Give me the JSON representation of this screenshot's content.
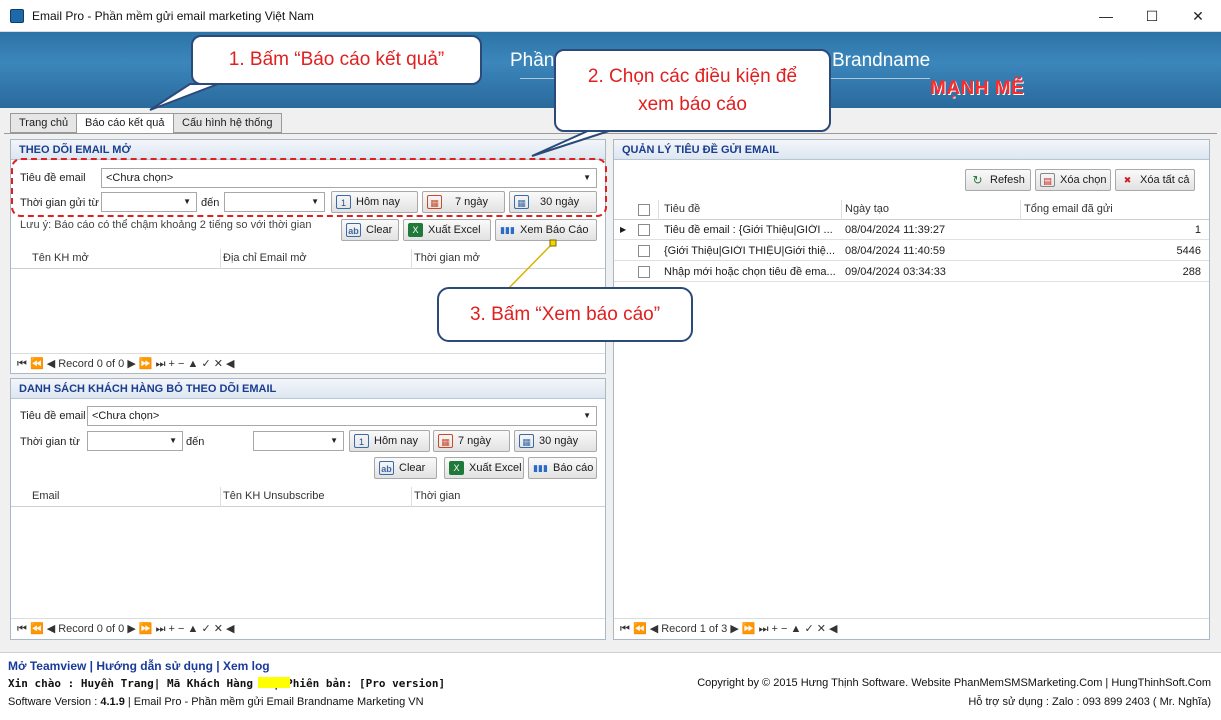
{
  "window": {
    "title": "Email Pro - Phần mềm gửi email marketing Việt Nam",
    "minimize": "—",
    "maximize": "☐",
    "close": "✕"
  },
  "banner": {
    "text1": "Phần",
    "text2": "Brandname",
    "text3": "MẠNH MẼ"
  },
  "tabs": [
    "Trang chủ",
    "Báo cáo kết quả",
    "Cấu hình hệ thống"
  ],
  "callouts": {
    "c1": "1. Bấm “Báo cáo kết quả”",
    "c2": "2. Chọn các điều kiện để xem báo cáo",
    "c3": "3. Bấm “Xem báo cáo”"
  },
  "open_panel": {
    "header": "THEO DÕI EMAIL MỞ",
    "subject_label": "Tiêu đề email",
    "subject_value": "<Chưa chọn>",
    "from_label": "Thời gian gửi từ",
    "to_label": "đến",
    "today": "Hôm nay",
    "d7": "7 ngày",
    "d30": "30 ngày",
    "note": "Lưu ý: Báo cáo có thể chậm khoảng 2 tiếng so với thời gian",
    "clear": "Clear",
    "excel": "Xuất Excel",
    "report": "Xem Báo Cáo",
    "columns": [
      "Tên KH mở",
      "Địa chỉ Email mở",
      "Thời gian mở"
    ],
    "nav": "⏮ ⏪ ◀ Record 0 of 0 ▶ ⏩ ⏭ + − ▲ ✓ ✕ ◀"
  },
  "unsub_panel": {
    "header": "DANH SÁCH KHÁCH HÀNG BỎ THEO DÕI EMAIL",
    "subject_label": "Tiêu đề email",
    "subject_value": "<Chưa chọn>",
    "from_label": "Thời gian từ",
    "to_label": "đến",
    "today": "Hôm nay",
    "d7": "7 ngày",
    "d30": "30 ngày",
    "clear": "Clear",
    "excel": "Xuất Excel",
    "report": "Báo cáo",
    "columns": [
      "Email",
      "Tên KH Unsubscribe",
      "Thời gian"
    ],
    "nav": "⏮ ⏪ ◀ Record 0 of 0 ▶ ⏩ ⏭ + − ▲ ✓ ✕ ◀"
  },
  "subject_panel": {
    "header": "QUẢN LÝ TIÊU ĐỀ GỬI EMAIL",
    "refresh": "Refesh",
    "del_sel": "Xóa chọn",
    "del_all": "Xóa tất cả",
    "columns": [
      "Tiêu đề",
      "Ngày tạo",
      "Tổng email đã gửi"
    ],
    "rows": [
      {
        "title": "Tiêu đề email : {Giới Thiệu|GIỚI ...",
        "date": "08/04/2024 11:39:27",
        "total": "1"
      },
      {
        "title": "{Giới Thiệu|GIỚI THIỆU|Giới thiệ...",
        "date": "08/04/2024 11:40:59",
        "total": "5446"
      },
      {
        "title": "Nhập mới hoặc chọn tiêu đề ema...",
        "date": "09/04/2024 03:34:33",
        "total": "288"
      }
    ],
    "nav": "⏮ ⏪ ◀ Record 1 of 3 ▶ ⏩ ⏭ + − ▲ ✓ ✕ ◀"
  },
  "footer": {
    "links": "Mở Teamview | Hướng dẫn sử dụng | Xem log",
    "greeting": "Xin chào : Huyền Trang| Mã Khách Hàng :       | Phiên bản: [Pro version]",
    "version_label": "Software Version :",
    "version": "4.1.9",
    "version_tail": "| Email Pro - Phần mềm gửi Email Brandname Marketing VN",
    "copyright": "Copyright by © 2015 Hưng Thịnh Software. Website PhanMemSMSMarketing.Com | HungThinhSoft.Com",
    "support": "Hỗ trợ sử dụng : Zalo : 093 899 2403 ( Mr. Nghĩa)"
  }
}
